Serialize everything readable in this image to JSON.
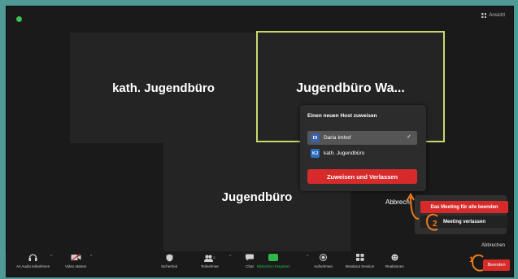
{
  "window": {
    "view_label": "Ansicht"
  },
  "tiles": [
    {
      "name": "kath. Jugendbüro"
    },
    {
      "name": "Jugendbüro  Wa..."
    },
    {
      "name": "Jugendbüro"
    }
  ],
  "host_dialog": {
    "title": "Einen neuen Host zuweisen",
    "participants": [
      {
        "initials": "DI",
        "name": "Daria Imhof",
        "selected": true
      },
      {
        "initials": "KJ",
        "name": "kath. Jugendbüro",
        "selected": false
      }
    ],
    "check": "✓",
    "assign_button": "Zuweisen und Verlassen",
    "cancel": "Abbrech"
  },
  "end_menu": {
    "end_for_all": "Das Meeting für alle beenden",
    "leave": "Meeting verlassen",
    "cancel": "Abbrechen"
  },
  "toolbar": {
    "audio": "An Audio teilnehmen",
    "video": "Video starten",
    "security": "Sicherheit",
    "participants": "Teilnehmer",
    "participants_count": "2",
    "chat": "Chat",
    "share": "Bildschirm freigeben",
    "record": "Aufnehmen",
    "breakout": "Breakout Session",
    "reactions": "Reaktionen",
    "end": "Beenden"
  },
  "colors": {
    "background": "#4f9a96",
    "end_red": "#d72b2b",
    "share_green": "#2fb84a",
    "active_speaker": "#c9d96b",
    "annotation_orange": "#f07b1a"
  }
}
